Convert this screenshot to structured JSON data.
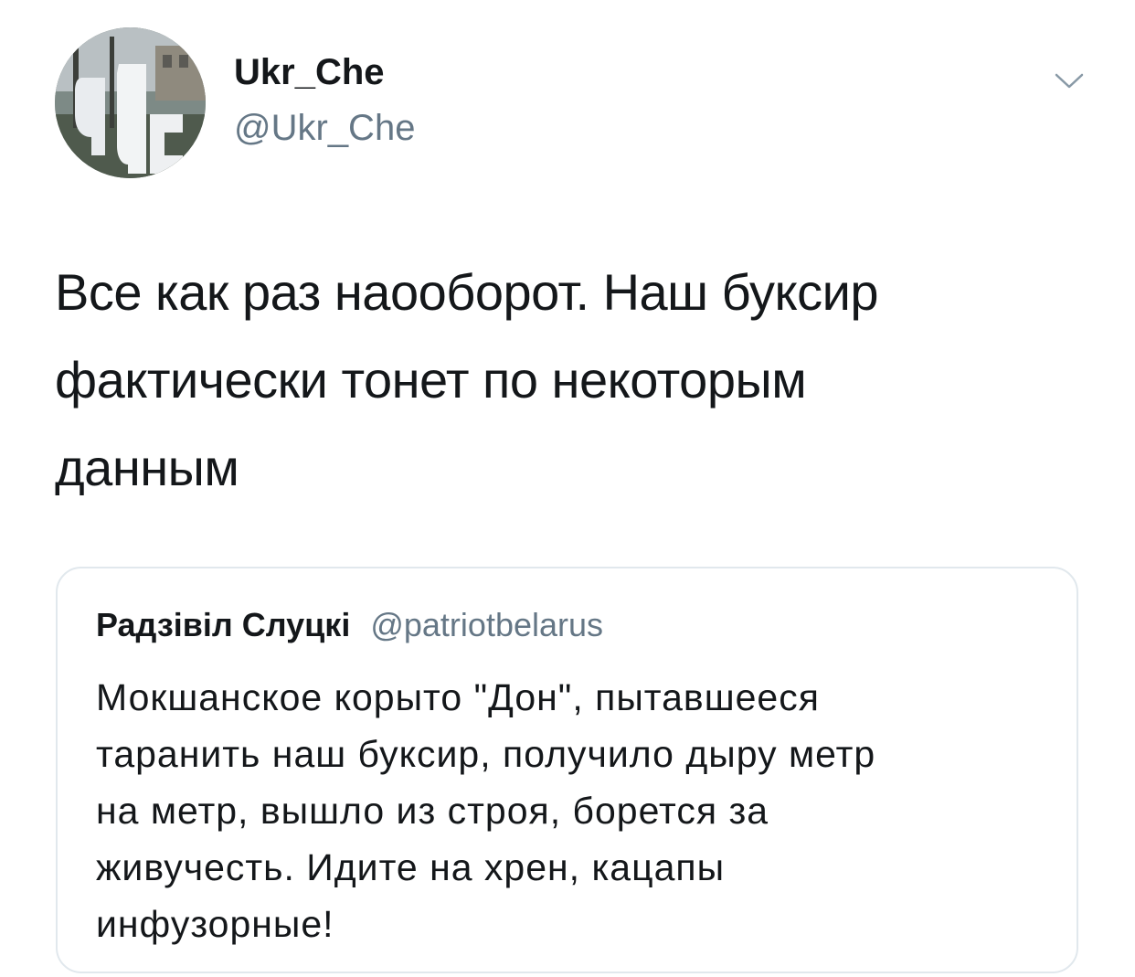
{
  "tweet": {
    "author": {
      "display_name": "Ukr_Che",
      "handle": "@Ukr_Che",
      "avatar_icon": "avatar-photo-icon"
    },
    "menu_icon": "chevron-down-icon",
    "text_lines": [
      "Все как раз наооборот. Наш буксир",
      "фактически тонет по некоторым",
      "данным"
    ],
    "quoted_tweet": {
      "display_name": "Радзівіл Слуцкі",
      "handle": "@patriotbelarus",
      "text_lines": [
        "Мокшанское корыто \"Дон\", пытавшееся",
        "таранить наш буксир, получило дыру метр",
        "на метр, вышло из строя, борется за",
        "живучесть. Идите на хрен, кацапы",
        "инфузорные!"
      ]
    }
  },
  "colors": {
    "primary_text": "#14171a",
    "secondary_text": "#657786",
    "border": "#e1e8ed",
    "background": "#ffffff"
  }
}
